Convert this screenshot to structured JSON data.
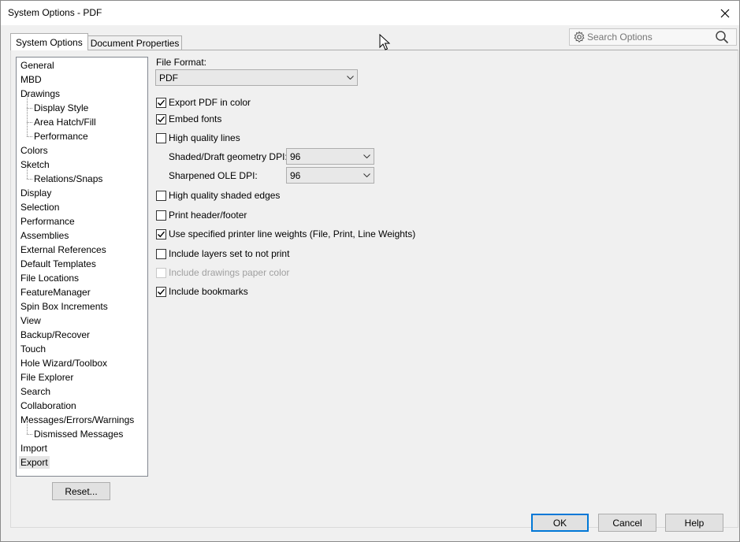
{
  "window": {
    "title": "System Options - PDF"
  },
  "tabs": [
    {
      "label": "System Options",
      "active": true
    },
    {
      "label": "Document Properties",
      "active": false
    }
  ],
  "search": {
    "placeholder": "Search Options"
  },
  "tree": {
    "items": [
      {
        "label": "General",
        "level": 0
      },
      {
        "label": "MBD",
        "level": 0
      },
      {
        "label": "Drawings",
        "level": 0
      },
      {
        "label": "Display Style",
        "level": 1
      },
      {
        "label": "Area Hatch/Fill",
        "level": 1
      },
      {
        "label": "Performance",
        "level": 1
      },
      {
        "label": "Colors",
        "level": 0
      },
      {
        "label": "Sketch",
        "level": 0
      },
      {
        "label": "Relations/Snaps",
        "level": 1
      },
      {
        "label": "Display",
        "level": 0
      },
      {
        "label": "Selection",
        "level": 0
      },
      {
        "label": "Performance",
        "level": 0
      },
      {
        "label": "Assemblies",
        "level": 0
      },
      {
        "label": "External References",
        "level": 0
      },
      {
        "label": "Default Templates",
        "level": 0
      },
      {
        "label": "File Locations",
        "level": 0
      },
      {
        "label": "FeatureManager",
        "level": 0
      },
      {
        "label": "Spin Box Increments",
        "level": 0
      },
      {
        "label": "View",
        "level": 0
      },
      {
        "label": "Backup/Recover",
        "level": 0
      },
      {
        "label": "Touch",
        "level": 0
      },
      {
        "label": "Hole Wizard/Toolbox",
        "level": 0
      },
      {
        "label": "File Explorer",
        "level": 0
      },
      {
        "label": "Search",
        "level": 0
      },
      {
        "label": "Collaboration",
        "level": 0
      },
      {
        "label": "Messages/Errors/Warnings",
        "level": 0
      },
      {
        "label": "Dismissed Messages",
        "level": 1
      },
      {
        "label": "Import",
        "level": 0
      },
      {
        "label": "Export",
        "level": 0,
        "selected": true
      }
    ]
  },
  "reset_label": "Reset...",
  "content": {
    "file_format_label": "File Format:",
    "file_format_value": "PDF",
    "options": {
      "export_color": {
        "label": "Export PDF in color",
        "checked": true
      },
      "embed_fonts": {
        "label": "Embed fonts",
        "checked": true
      },
      "high_quality_lines": {
        "label": "High quality lines",
        "checked": false
      },
      "high_quality_edges": {
        "label": "High quality shaded edges",
        "checked": false
      },
      "print_header": {
        "label": "Print header/footer",
        "checked": false
      },
      "printer_weights": {
        "label": "Use specified printer line weights (File, Print, Line Weights)",
        "checked": true
      },
      "include_layers": {
        "label": "Include layers set to not print",
        "checked": false
      },
      "paper_color": {
        "label": "Include drawings paper color",
        "checked": false,
        "disabled": true
      },
      "bookmarks": {
        "label": "Include bookmarks",
        "checked": true
      }
    },
    "shaded_dpi_label": "Shaded/Draft geometry DPI:",
    "shaded_dpi_value": "96",
    "ole_dpi_label": "Sharpened OLE DPI:",
    "ole_dpi_value": "96"
  },
  "footer": {
    "ok": "OK",
    "cancel": "Cancel",
    "help": "Help"
  },
  "colors": {
    "focus_border": "#0078d7",
    "background": "#f0f0f0"
  }
}
